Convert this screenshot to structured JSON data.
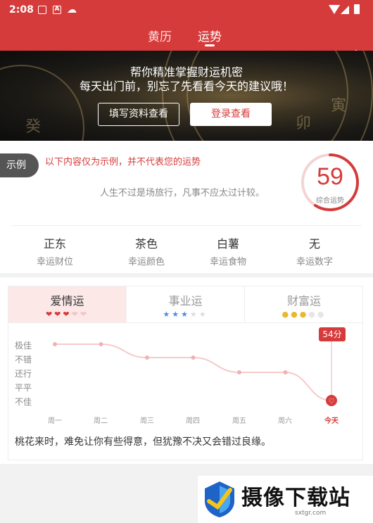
{
  "status": {
    "time": "2:08"
  },
  "nav": {
    "tabs": [
      "黄历",
      "运势"
    ],
    "active_tab": "运势"
  },
  "banner": {
    "line1": "帮你精准掌握财运机密",
    "line2": "每天出门前，别忘了先看看今天的建议哦！",
    "fill_button": "填写资料查看",
    "login_button": "登录查看"
  },
  "summary": {
    "example_tag": "示例",
    "note": "以下内容仅为示例，并不代表您的运势",
    "quote": "人生不过是场旅行，凡事不应太过计较。",
    "score": "59",
    "score_label": "综合运势",
    "score_fraction": 0.59,
    "lucky": [
      {
        "value": "正东",
        "label": "幸运财位"
      },
      {
        "value": "茶色",
        "label": "幸运颜色"
      },
      {
        "value": "白薯",
        "label": "幸运食物"
      },
      {
        "value": "无",
        "label": "幸运数字"
      }
    ]
  },
  "fortune": {
    "tabs": [
      {
        "name": "爱情运",
        "rating": 3,
        "max": 5,
        "icon": "heart-icon"
      },
      {
        "name": "事业运",
        "rating": 3,
        "max": 5,
        "icon": "star-icon"
      },
      {
        "name": "财富运",
        "rating": 3,
        "max": 5,
        "icon": "coin-icon"
      }
    ],
    "active_tab": "爱情运",
    "levels": [
      "极佳",
      "不错",
      "还行",
      "平平",
      "不佳"
    ],
    "days": [
      "周一",
      "周二",
      "周三",
      "周四",
      "周五",
      "周六",
      "今天"
    ],
    "today_score": "54分",
    "description": "桃花来时，难免让你有些得意，但犹豫不决又会错过良缘。"
  },
  "chart_data": {
    "type": "line",
    "categories": [
      "周一",
      "周二",
      "周三",
      "周四",
      "周五",
      "周六",
      "今天"
    ],
    "y_categories": [
      "不佳",
      "平平",
      "还行",
      "不错",
      "极佳"
    ],
    "values": [
      4,
      4,
      3.05,
      3.05,
      2,
      2,
      0
    ],
    "ylim": [
      0,
      4
    ],
    "annotation": "54分"
  },
  "watermark": {
    "name": "摄像下载站",
    "url": "sxtgr.com"
  }
}
